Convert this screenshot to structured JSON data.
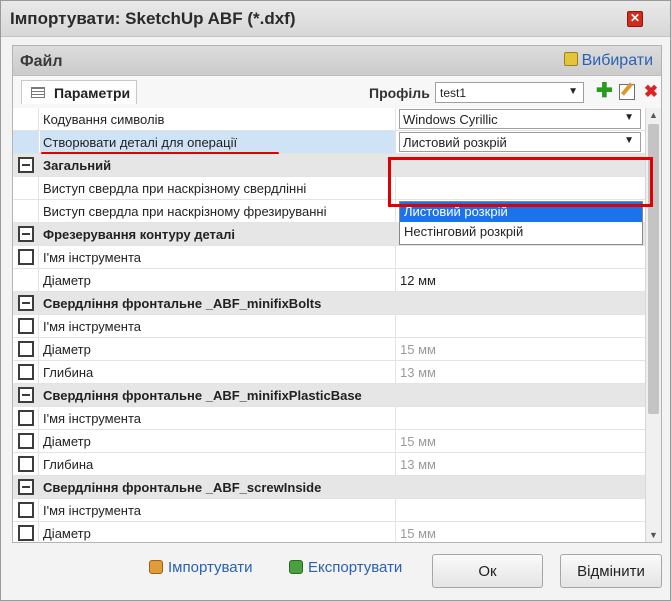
{
  "dialog": {
    "title": "Імпортувати: SketchUp ABF (*.dxf)",
    "close_glyph": "✕"
  },
  "panel": {
    "title": "Файл",
    "choose_label": "Вибирати",
    "choose_icon": "folder-open-icon"
  },
  "tab": {
    "label": "Параметри"
  },
  "profile": {
    "label": "Профіль",
    "value": "test1",
    "add_glyph": "✚",
    "delete_glyph": "✖"
  },
  "grid": {
    "encoding": {
      "label": "Кодування символів",
      "value": "Windows Cyrillic"
    },
    "create_parts": {
      "label": "Створювати деталі для операції",
      "value": "Листовий розкрій"
    },
    "dropdown_options": [
      "Листовий розкрій",
      "Нестінговий розкрій"
    ],
    "general": {
      "title": "Загальний",
      "drill_through_drilling": "Виступ свердла при наскрізному свердлінні",
      "drill_through_milling": "Виступ свердла при наскрізному фрезируванні"
    },
    "contour": {
      "title": "Фрезерування контуру деталі",
      "tool_name": "І'мя інструмента",
      "diameter_label": "Діаметр",
      "diameter_value": "12 мм"
    },
    "bolts": {
      "title": "Свердління фронтальне _ABF_minifixBolts",
      "tool_name": "І'мя інструмента",
      "diameter_label": "Діаметр",
      "diameter_value": "15 мм",
      "depth_label": "Глибина",
      "depth_value": "13 мм"
    },
    "plastic": {
      "title": "Свердління фронтальне _ABF_minifixPlasticBase",
      "tool_name": "І'мя інструмента",
      "diameter_label": "Діаметр",
      "diameter_value": "15 мм",
      "depth_label": "Глибина",
      "depth_value": "13 мм"
    },
    "screw": {
      "title": "Свердління фронтальне _ABF_screwInside",
      "tool_name": "І'мя інструмента",
      "diameter_label": "Діаметр",
      "diameter_value": "15 мм"
    }
  },
  "footer": {
    "import_label": "Імпортувати",
    "export_label": "Експортувати",
    "ok_label": "Ок",
    "cancel_label": "Відмінити"
  },
  "colors": {
    "accent_link": "#2a62b3",
    "highlight_red": "#e00000",
    "selected_option": "#1a73e8"
  }
}
